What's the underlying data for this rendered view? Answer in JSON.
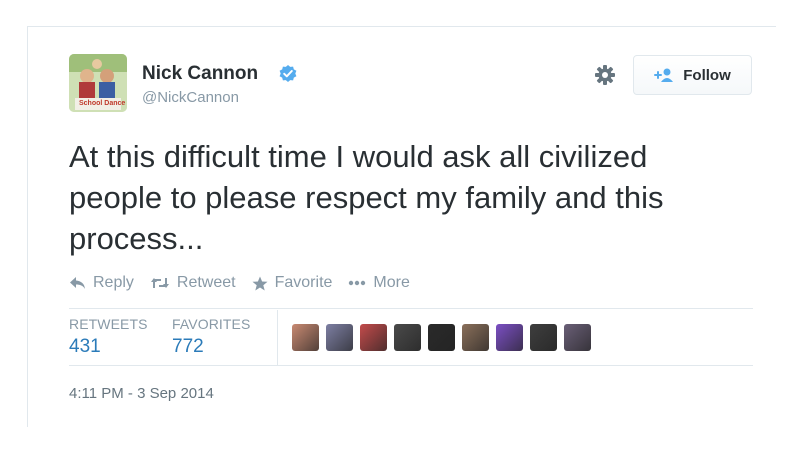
{
  "user": {
    "name": "Nick Cannon",
    "handle": "@NickCannon",
    "avatar_caption": "School Dance"
  },
  "follow_label": "Follow",
  "tweet": {
    "text": "At this difficult time I would ask all civilized people to please respect my family and this process..."
  },
  "actions": {
    "reply": "Reply",
    "retweet": "Retweet",
    "favorite": "Favorite",
    "more": "More"
  },
  "stats": {
    "retweets_label": "RETWEETS",
    "retweets_value": "431",
    "favorites_label": "FAVORITES",
    "favorites_value": "772"
  },
  "favoriter_avatar_colors": [
    "#c98a72",
    "#7d7fa3",
    "#c34b4b",
    "#4a4a4a",
    "#2a2a2a",
    "#8a6f5a",
    "#7b4fc4",
    "#3e3e3e",
    "#6a5f77"
  ],
  "timestamp": "4:11 PM - 3 Sep 2014",
  "colors": {
    "verified": "#55acee",
    "link": "#2b7bb9",
    "muted": "#8899a6"
  }
}
